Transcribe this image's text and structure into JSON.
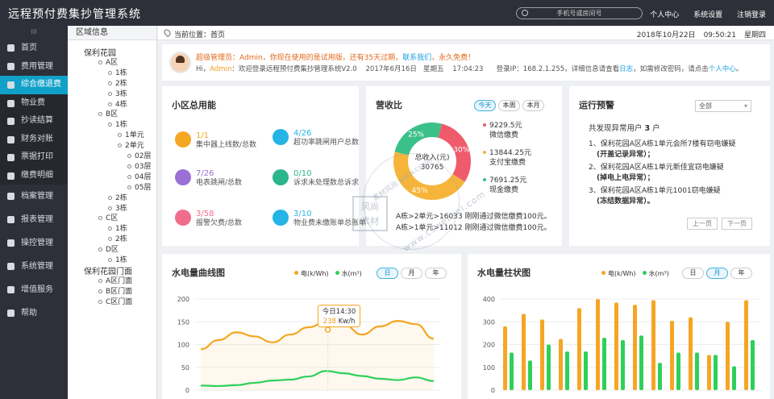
{
  "app": {
    "title": "远程预付费集抄管理系统",
    "search_placeholder": "手机号或房间号",
    "links": [
      "个人中心",
      "系统设置",
      "注销登录"
    ]
  },
  "sidebar": {
    "collapse": "III",
    "items": [
      {
        "label": "首页",
        "icon": "home-icon",
        "type": "main"
      },
      {
        "label": "费用管理",
        "icon": "money-icon",
        "type": "main"
      },
      {
        "label": "综合缴退费",
        "icon": "grid-icon",
        "type": "active"
      },
      {
        "label": "物业费",
        "icon": "house-icon",
        "type": "sub"
      },
      {
        "label": "抄读结算",
        "icon": "read-icon",
        "type": "sub"
      },
      {
        "label": "财务对账",
        "icon": "finance-icon",
        "type": "sub"
      },
      {
        "label": "票据打印",
        "icon": "print-icon",
        "type": "sub"
      },
      {
        "label": "缴费明细",
        "icon": "list-icon",
        "type": "sub"
      },
      {
        "label": "档案管理",
        "icon": "archive-icon",
        "type": "sec"
      },
      {
        "label": "报表管理",
        "icon": "report-icon",
        "type": "sec"
      },
      {
        "label": "操控管理",
        "icon": "control-icon",
        "type": "sec"
      },
      {
        "label": "系统管理",
        "icon": "system-icon",
        "type": "sec"
      },
      {
        "label": "增值服务",
        "icon": "service-icon",
        "type": "sec"
      },
      {
        "label": "帮助",
        "icon": "help-icon",
        "type": "sec"
      }
    ]
  },
  "tree": {
    "title": "区域信息",
    "nodes": [
      {
        "t": "保利花园",
        "d": 0
      },
      {
        "t": "A区",
        "d": 1
      },
      {
        "t": "1栋",
        "d": 2
      },
      {
        "t": "2栋",
        "d": 2
      },
      {
        "t": "3栋",
        "d": 2
      },
      {
        "t": "4栋",
        "d": 2
      },
      {
        "t": "B区",
        "d": 1
      },
      {
        "t": "1栋",
        "d": 2
      },
      {
        "t": "1单元",
        "d": 3
      },
      {
        "t": "2单元",
        "d": 3
      },
      {
        "t": "02层",
        "d": 4
      },
      {
        "t": "03层",
        "d": 4
      },
      {
        "t": "04层",
        "d": 4
      },
      {
        "t": "05层",
        "d": 4
      },
      {
        "t": "2栋",
        "d": 2
      },
      {
        "t": "3栋",
        "d": 2
      },
      {
        "t": "C区",
        "d": 1
      },
      {
        "t": "1栋",
        "d": 2
      },
      {
        "t": "2栋",
        "d": 2
      },
      {
        "t": "D区",
        "d": 1
      },
      {
        "t": "1栋",
        "d": 2
      },
      {
        "t": "保利花园门面",
        "d": 0
      },
      {
        "t": "A区门面",
        "d": 1
      },
      {
        "t": "B区门面",
        "d": 1
      },
      {
        "t": "C区门面",
        "d": 1
      }
    ]
  },
  "breadcrumb": {
    "label": "当前位置：",
    "page": "首页",
    "date": "2018年10月22日",
    "time": "09:50:21",
    "weekday": "星期四"
  },
  "welcome": {
    "line1_a": "超级管理员：Admin，你现在使用的是试用版，还有35天过期，",
    "line1_link": "联系我们",
    "line1_b": "，永久免费！",
    "line2_a": "Hi，",
    "line2_user": "Admin",
    "line2_b": "：欢迎登录远程预付费集抄管理系统V2.0    2017年6月16日   星期五    17:04:23      登录IP：168.2.1.255，详细信息请查看",
    "line2_log": "日志",
    "line2_c": "，如需修改密码，请点击",
    "line2_pc": "个人中心",
    "line2_d": "。"
  },
  "usage": {
    "title": "小区总用能",
    "items": [
      {
        "num": "1/1",
        "label": "集中器上线数/总数",
        "color": "#f5a623"
      },
      {
        "num": "4/26",
        "label": "超功率跳闸用户总数",
        "color": "#25b4e6"
      },
      {
        "num": "7/26",
        "label": "电表跳闸/总数",
        "color": "#9b6fd6"
      },
      {
        "num": "0/10",
        "label": "诉求未处理数总诉求",
        "color": "#2bb58a"
      },
      {
        "num": "3/58",
        "label": "报警欠费/总数",
        "color": "#f06e8c"
      },
      {
        "num": "3/10",
        "label": "物业费未缴账单总账单",
        "color": "#25b4e6"
      }
    ]
  },
  "revenue": {
    "title": "营收比",
    "tabs": [
      "今天",
      "本周",
      "本月"
    ],
    "center_label": "总收入(元)",
    "center_value": "30765",
    "items": [
      {
        "value": "9229.5元",
        "label": "微信缴费",
        "color": "#ef5b6b"
      },
      {
        "value": "13844.25元",
        "label": "支付宝缴费",
        "color": "#f6b53a"
      },
      {
        "value": "7691.25元",
        "label": "现金缴费",
        "color": "#3cc08a"
      }
    ],
    "slices": [
      {
        "pct": 30,
        "label": "30%",
        "color": "#ef5b6b"
      },
      {
        "pct": 45,
        "label": "45%",
        "color": "#f6b53a"
      },
      {
        "pct": 25,
        "label": "25%",
        "color": "#3cc08a"
      }
    ],
    "messages": [
      "A栋>2单元>16033 刚刚通过微信缴费100元。",
      "A栋>1单元>11012 刚刚通过微信缴费100元。"
    ]
  },
  "alarm": {
    "title": "运行预警",
    "select": "全部",
    "summary_a": "共发现异常用户 ",
    "summary_n": "3",
    "summary_b": " 户",
    "items": [
      {
        "line": "1、保利花园A区A栋1单元会所7楼有窃电嫌疑",
        "sub": "(开盖记录异常）；"
      },
      {
        "line": "2、保利花园A区A栋1单元新佳宜窃电嫌疑",
        "sub": "(掉电上电异常）；"
      },
      {
        "line": "3、保利花园A区A栋1单元1001窃电嫌疑",
        "sub": "(冻结数据异常）。"
      }
    ],
    "prev": "上一页",
    "next": "下一页"
  },
  "line_chart": {
    "title": "水电量曲线图",
    "legend": [
      "电(k/Wh)",
      "水(m³)"
    ],
    "tabs": [
      "日",
      "月",
      "年"
    ],
    "tooltip_title": "今日14:30",
    "tooltip_value": "238",
    "tooltip_unit": "Kw/h"
  },
  "bar_chart": {
    "title": "水电量柱状图",
    "legend": [
      "电(k/Wh)",
      "水(m³)"
    ],
    "tabs": [
      "日",
      "月",
      "年"
    ]
  },
  "chart_data": [
    {
      "type": "line",
      "yticks": [
        "200",
        "150",
        "100",
        "50",
        "0"
      ],
      "ylim": [
        0,
        200
      ],
      "series": [
        {
          "name": "电(k/Wh)",
          "color": "#f5a623",
          "values": [
            90,
            110,
            127,
            118,
            105,
            122,
            138,
            150,
            143,
            122,
            140,
            152,
            145,
            113
          ]
        },
        {
          "name": "水(m³)",
          "color": "#2fd05a",
          "values": [
            10,
            9,
            11,
            16,
            21,
            23,
            30,
            42,
            37,
            31,
            25,
            22,
            28,
            20
          ]
        }
      ]
    },
    {
      "type": "bar",
      "yticks": [
        "400",
        "300",
        "200",
        "100",
        "0"
      ],
      "ylim": [
        0,
        400
      ],
      "series": [
        {
          "name": "电(k/Wh)",
          "color": "#f5a623",
          "values": [
            280,
            335,
            310,
            225,
            360,
            400,
            385,
            375,
            395,
            305,
            320,
            155,
            300,
            395
          ]
        },
        {
          "name": "水(m³)",
          "color": "#2fd05a",
          "values": [
            165,
            130,
            200,
            170,
            170,
            230,
            220,
            240,
            120,
            165,
            165,
            155,
            105,
            220
          ]
        }
      ]
    }
  ],
  "watermark": {
    "line1": "风尚",
    "line2": "素材",
    "side": "素材风尚 www.cswei",
    "url": "www.csweiwei.com"
  }
}
